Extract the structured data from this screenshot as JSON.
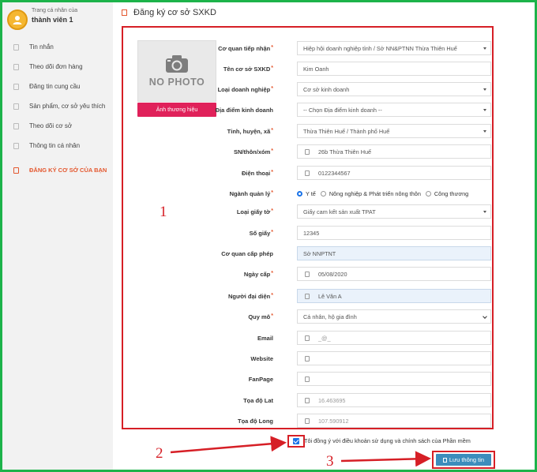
{
  "sidebar": {
    "profile_caption": "Trang cá nhân của",
    "profile_name": "thành viên 1",
    "items": [
      {
        "label": "Tin nhắn"
      },
      {
        "label": "Theo dõi đơn hàng"
      },
      {
        "label": "Đăng tin cung cầu"
      },
      {
        "label": "Sản phẩm, cơ sở yêu thích"
      },
      {
        "label": "Theo dõi cơ sở"
      },
      {
        "label": "Thông tin cá nhân"
      },
      {
        "label": "ĐĂNG KÝ CƠ SỞ CỦA BẠN"
      }
    ]
  },
  "page": {
    "title": "Đăng ký cơ sở SXKD",
    "no_photo": "NO PHOTO",
    "brand_image_button": "Ảnh thương hiệu"
  },
  "form": {
    "co_quan_tiep_nhan": {
      "label": "Cơ quan tiếp nhận",
      "value": "Hiệp hội doanh nghiệp tỉnh / Sở NN&PTNN Thừa Thiên Huế"
    },
    "ten_co_so": {
      "label": "Tên cơ sở SXKD",
      "value": "Kim Oanh"
    },
    "loai_doanh_nghiep": {
      "label": "Loại doanh nghiệp",
      "value": "Cơ sở kinh doanh"
    },
    "dia_diem": {
      "label": "Địa điểm kinh doanh",
      "value": "-- Chọn Địa điểm kinh doanh --"
    },
    "tinh_huyen_xa": {
      "label": "Tỉnh, huyện, xã",
      "value": "Thừa Thiên Huế / Thành phố Huế"
    },
    "sn_thon_xom": {
      "label": "SN/thôn/xóm",
      "value": "26b Thừa Thiên Huế"
    },
    "dien_thoai": {
      "label": "Điện thoại",
      "value": "0122344567"
    },
    "nganh_quan_ly": {
      "label": "Ngành quản lý",
      "options": [
        "Y tế",
        "Nông nghiệp & Phát triển nông thôn",
        "Công thương"
      ],
      "selected": "Y tế"
    },
    "loai_giay_to": {
      "label": "Loại giấy tờ",
      "value": "Giấy cam kết sản xuất TPAT"
    },
    "so_giay": {
      "label": "Số giấy",
      "value": "12345"
    },
    "co_quan_cap_phep": {
      "label": "Cơ quan cấp phép",
      "value": "Sở NNPTNT"
    },
    "ngay_cap": {
      "label": "Ngày cấp",
      "value": "05/08/2020"
    },
    "nguoi_dai_dien": {
      "label": "Người đại diện",
      "value": "Lê Văn A"
    },
    "quy_mo": {
      "label": "Quy mô",
      "value": "Cá nhân, hộ gia đình"
    },
    "email": {
      "label": "Email",
      "placeholder": "_@_"
    },
    "website": {
      "label": "Website",
      "value": ""
    },
    "fanpage": {
      "label": "FanPage",
      "value": ""
    },
    "toa_do_lat": {
      "label": "Tọa độ Lat",
      "value": "16.463695"
    },
    "toa_do_long": {
      "label": "Tọa độ Long",
      "value": "107.590912"
    }
  },
  "agree_text": "Tôi đồng ý với điều khoản sử dụng và chính sách của Phần mềm",
  "save_button": "Lưu thông tin",
  "annotations": {
    "n1": "1",
    "n2": "2",
    "n3": "3"
  },
  "colors": {
    "frame": "#1db34a",
    "highlight": "#d61f26",
    "brand_button": "#e0215a",
    "save_button": "#3c8dbc",
    "accent": "#e4572e"
  }
}
